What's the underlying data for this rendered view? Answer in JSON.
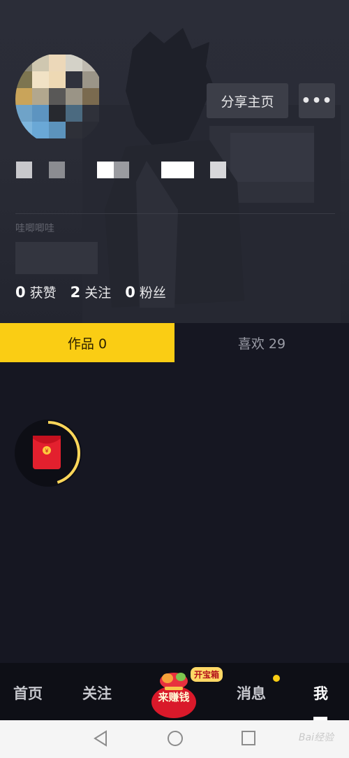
{
  "profile": {
    "share_label": "分享主页",
    "more_label": "•••",
    "bio": "哇唧唧哇"
  },
  "stats": [
    {
      "num": "0",
      "label": "获赞"
    },
    {
      "num": "2",
      "label": "关注"
    },
    {
      "num": "0",
      "label": "粉丝"
    }
  ],
  "tabs": {
    "works": "作品 0",
    "likes": "喜欢 29"
  },
  "redpack": {
    "progress": 0.45,
    "icon": "red-envelope-icon"
  },
  "bottom_nav": {
    "home": "首页",
    "follow": "关注",
    "earn": "来赚钱",
    "chest": "开宝箱",
    "messages": "消息",
    "me": "我"
  },
  "colors": {
    "accent": "#facd14",
    "background": "#161722",
    "red": "#e3202e"
  },
  "watermark": "Bai经验"
}
